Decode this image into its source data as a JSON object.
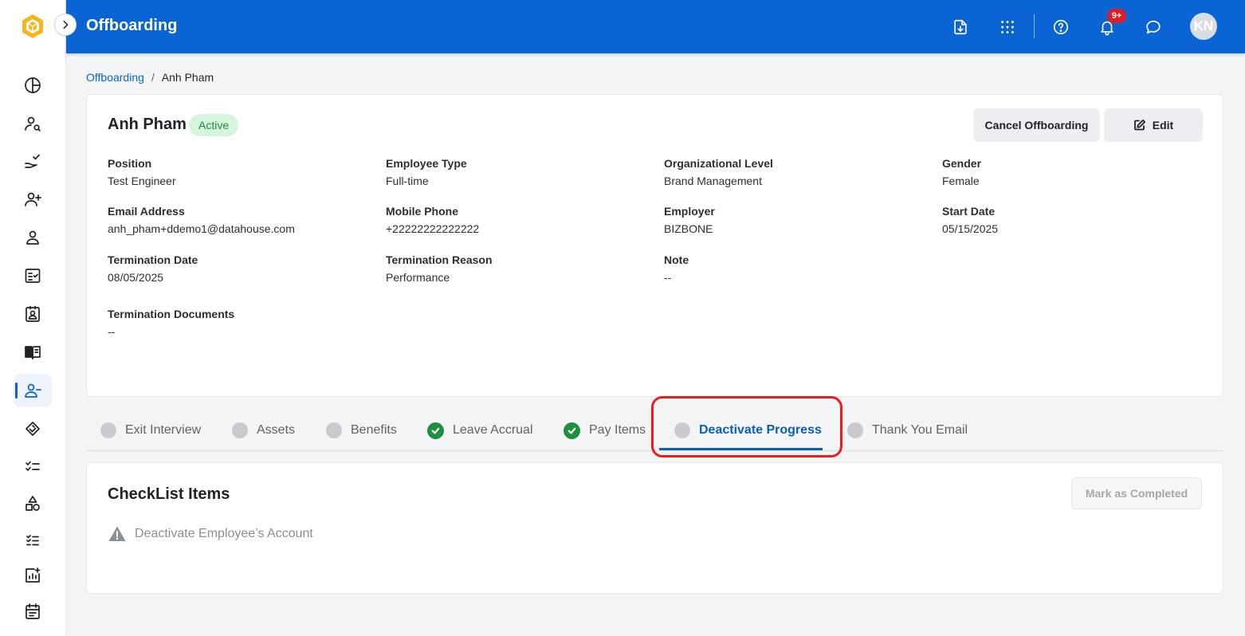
{
  "app": {
    "title": "Offboarding",
    "notification_count": "9+",
    "user_initials": "KN",
    "brand_color": "#0a64d3",
    "logo_color": "#f5b51b"
  },
  "sidebar": {
    "items": [
      {
        "icon": "pie-chart-icon"
      },
      {
        "icon": "user-search-icon"
      },
      {
        "icon": "hand-check-icon"
      },
      {
        "icon": "user-add-icon"
      },
      {
        "icon": "user-icon"
      },
      {
        "icon": "checklist-board-icon"
      },
      {
        "icon": "id-badge-icon"
      },
      {
        "icon": "book-icon"
      },
      {
        "icon": "user-remove-icon",
        "active": true
      },
      {
        "icon": "handshake-icon"
      },
      {
        "icon": "check-list-icon"
      },
      {
        "icon": "shapes-icon"
      },
      {
        "icon": "task-list-icon"
      },
      {
        "icon": "chart-add-icon"
      },
      {
        "icon": "calendar-icon"
      }
    ]
  },
  "breadcrumb": {
    "parent": "Offboarding",
    "separator": "/",
    "current": "Anh Pham"
  },
  "employee": {
    "name": "Anh Pham",
    "status": "Active",
    "cancel_label": "Cancel Offboarding",
    "edit_label": "Edit",
    "fields": [
      {
        "label": "Position",
        "value": "Test Engineer"
      },
      {
        "label": "Employee Type",
        "value": "Full-time"
      },
      {
        "label": "Organizational Level",
        "value": "Brand Management"
      },
      {
        "label": "Gender",
        "value": "Female"
      },
      {
        "label": "Email Address",
        "value": "anh_pham+ddemo1@datahouse.com"
      },
      {
        "label": "Mobile Phone",
        "value": "+22222222222222"
      },
      {
        "label": "Employer",
        "value": "BIZBONE"
      },
      {
        "label": "Start Date",
        "value": "05/15/2025"
      },
      {
        "label": "Termination Date",
        "value": "08/05/2025"
      },
      {
        "label": "Termination Reason",
        "value": "Performance"
      },
      {
        "label": "Note",
        "value": "--"
      },
      {
        "label": "Termination Documents",
        "value": "--"
      }
    ]
  },
  "tabs": [
    {
      "label": "Exit Interview",
      "done": false
    },
    {
      "label": "Assets",
      "done": false
    },
    {
      "label": "Benefits",
      "done": false
    },
    {
      "label": "Leave Accrual",
      "done": true
    },
    {
      "label": "Pay Items",
      "done": true
    },
    {
      "label": "Deactivate Progress",
      "done": false,
      "active": true
    },
    {
      "label": "Thank You Email",
      "done": false
    }
  ],
  "checklist": {
    "title": "CheckList Items",
    "mark_completed_label": "Mark as Completed",
    "items": [
      {
        "label": "Deactivate Employee’s Account",
        "icon": "warning-icon"
      }
    ]
  }
}
